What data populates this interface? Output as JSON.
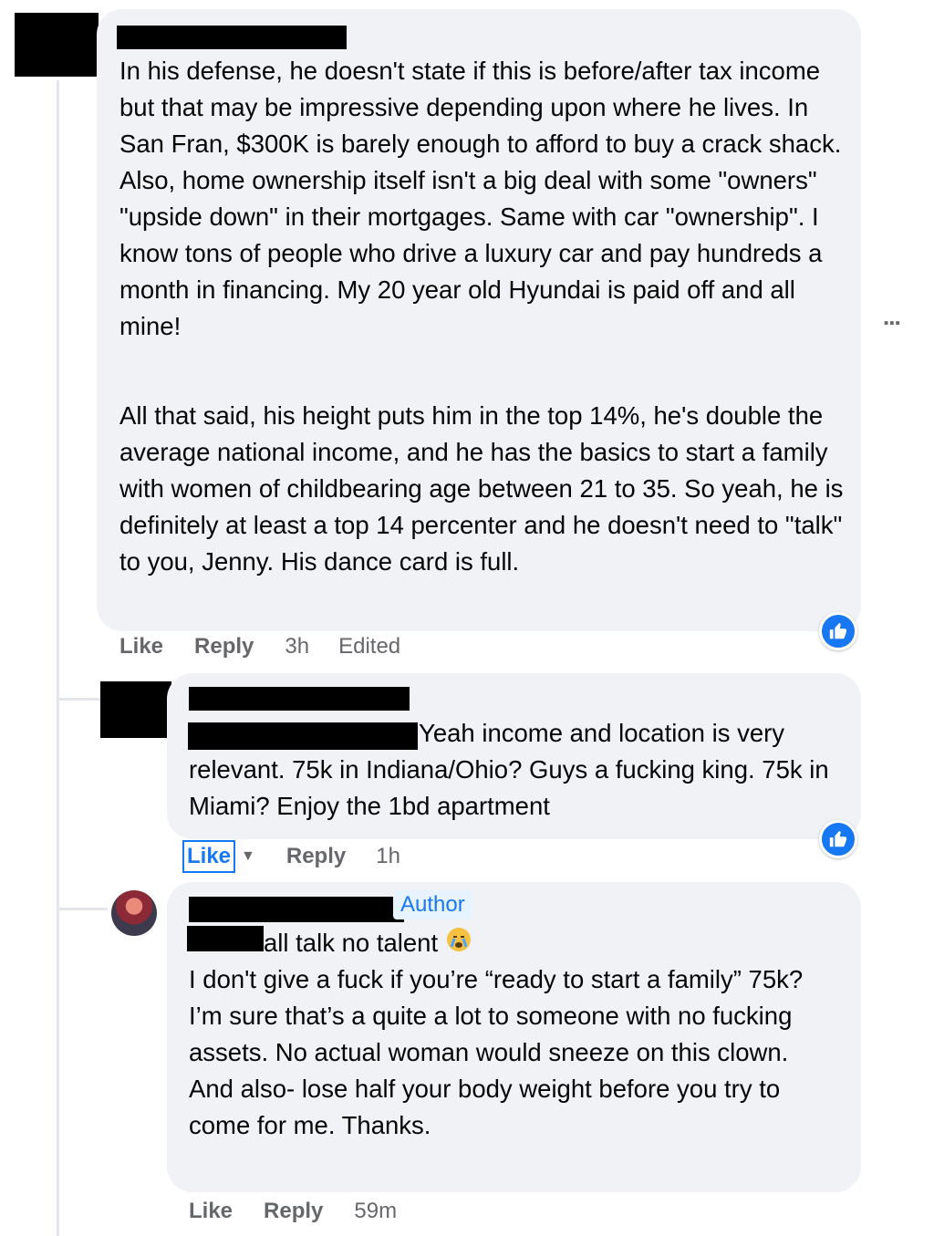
{
  "comments": [
    {
      "paragraphs": [
        "In his defense, he doesn't state if this is before/after tax income but that may be impressive depending upon where he lives. In San Fran, $300K is barely enough to afford to buy a crack shack. Also, home ownership itself isn't a big deal with some \"owners\" \"upside down\" in their mortgages. Same with car \"ownership\". I know tons of people who drive a luxury car and pay hundreds a month in financing. My 20 year old Hyundai is paid off and all mine!",
        "All that said, his height puts him in the top 14%, he's double the average national income, and he has the basics to start a family with women of childbearing age between 21 to 35. So yeah, he is definitely at least a top 14 percenter and he doesn't need to \"talk\" to you, Jenny. His dance card is full."
      ],
      "like": "Like",
      "reply": "Reply",
      "time": "3h",
      "edited": "Edited"
    },
    {
      "text": "Yeah income and location is very relevant. 75k in Indiana/Ohio? Guys a fucking king. 75k in Miami? Enjoy the 1bd apartment",
      "like": "Like",
      "reply": "Reply",
      "time": "1h"
    },
    {
      "author_badge": "Author",
      "line1": "all talk no talent",
      "text": "I don't give a fuck if you’re “ready to start a family” 75k? I’m sure that’s a quite a lot to someone with no fucking assets. No actual woman would sneeze on this clown.\nAnd also- lose half your body weight before you try to come for me. Thanks.",
      "like": "Like",
      "reply": "Reply",
      "time": "59m"
    }
  ],
  "more_options": "...",
  "colors": {
    "bubble": "#f0f2f5",
    "secondary_text": "#65676b",
    "accent": "#1877f2"
  },
  "icons": [
    "like-thumb-icon",
    "crying-emoji-icon",
    "dropdown-arrow-icon",
    "more-options-icon"
  ]
}
